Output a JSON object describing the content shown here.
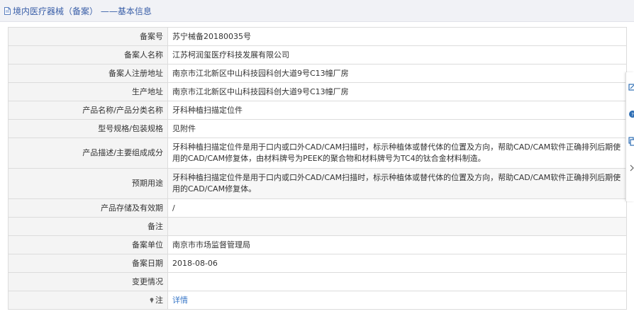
{
  "header": {
    "title": "境内医疗器械（备案） ——基本信息"
  },
  "fields": [
    {
      "label": "备案号",
      "value": "苏宁械备20180035号"
    },
    {
      "label": "备案人名称",
      "value": "江苏柯润玺医疗科技发展有限公司"
    },
    {
      "label": "备案人注册地址",
      "value": "南京市江北新区中山科技园科创大道9号C13幢厂房"
    },
    {
      "label": "生产地址",
      "value": "南京市江北新区中山科技园科创大道9号C13幢厂房"
    },
    {
      "label": "产品名称/产品分类名称",
      "value": "牙科种植扫描定位件"
    },
    {
      "label": "型号规格/包装规格",
      "value": "见附件"
    },
    {
      "label": "产品描述/主要组成成分",
      "value": "牙科种植扫描定位件是用于口内或口外CAD/CAM扫描时，标示种植体或替代体的位置及方向，帮助CAD/CAM软件正确排列后期使用的CAD/CAM修复体，由材料牌号为PEEK的聚合物和材料牌号为TC4的钛合金材料制造。"
    },
    {
      "label": "预期用途",
      "value": "牙科种植扫描定位件是用于口内或口外CAD/CAM扫描时，标示种植体或替代体的位置及方向，帮助CAD/CAM软件正确排列后期使用的CAD/CAM修复体。"
    },
    {
      "label": "产品存储及有效期",
      "value": "/"
    },
    {
      "label": "备注",
      "value": ""
    },
    {
      "label": "备案单位",
      "value": "南京市市场监督管理局"
    },
    {
      "label": "备案日期",
      "value": "2018-08-06"
    },
    {
      "label": "变更情况",
      "value": ""
    }
  ],
  "note_row": {
    "label": "注",
    "link_text": "详情",
    "icon": "pin-icon"
  },
  "side_toolbar": {
    "icons": [
      "edit-icon",
      "help-icon",
      "copy-icon",
      "chevron-right-icon"
    ]
  },
  "colors": {
    "title": "#3a5fa8",
    "link": "#3a78c8",
    "label_bg": "#f4f4f4",
    "border": "#dcdcdc"
  }
}
